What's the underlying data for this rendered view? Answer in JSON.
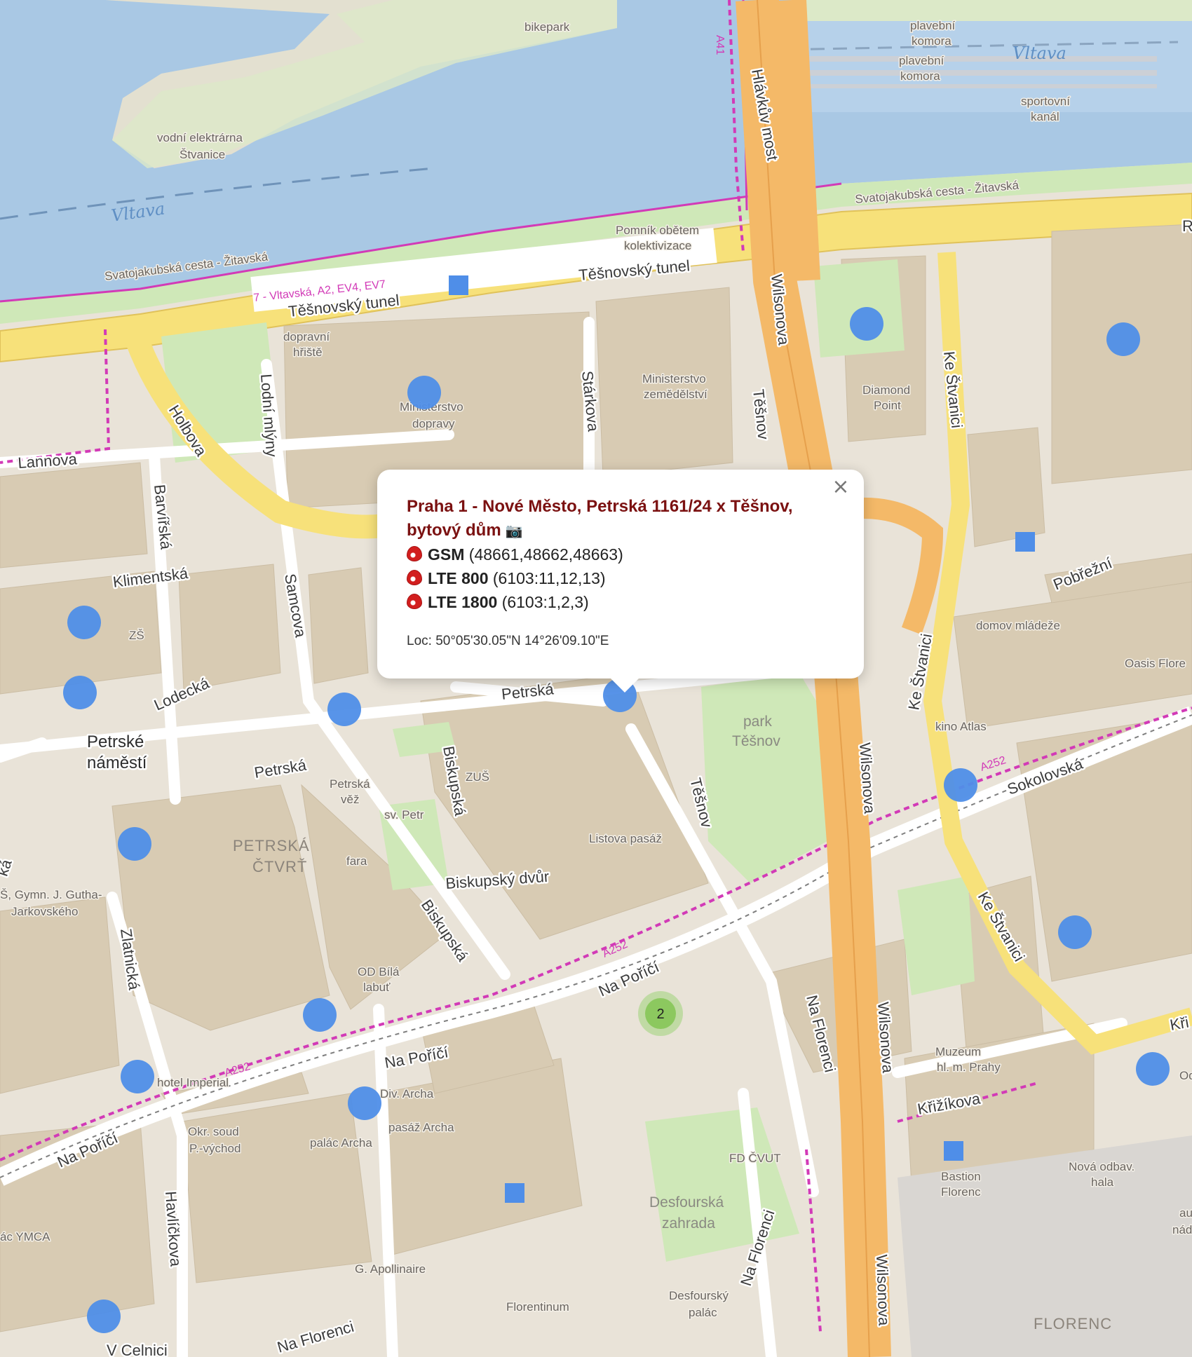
{
  "popup": {
    "title": "Praha 1 - Nové Město, Petrská 1161/24 x Těšnov, bytový dům",
    "camera_icon": "camera-icon",
    "close_glyph": "×",
    "technologies": [
      {
        "name": "GSM",
        "ids": "(48661,48662,48663)"
      },
      {
        "name": "LTE 800",
        "ids": "(6103:11,12,13)"
      },
      {
        "name": "LTE 1800",
        "ids": "(6103:1,2,3)"
      }
    ],
    "location": "Loc: 50°05'30.05\"N 14°26'09.10\"E"
  },
  "cluster": {
    "count": "2"
  },
  "labels": {
    "bikepark": "bikepark",
    "plavebni_komora_1a": "plavební",
    "plavebni_komora_1b": "komora",
    "plavebni_komora_2a": "plavební",
    "plavebni_komora_2b": "komora",
    "vltava_top": "Vltava",
    "vltava_left": "Vltava",
    "sportovni_kanal_a": "sportovní",
    "sportovni_kanal_b": "kanál",
    "vodni_elektrarna_a": "vodní elektrárna",
    "vodni_elektrarna_b": "Štvanice",
    "a41": "A41",
    "havlickuv_most": "Hlávkův most",
    "svatojakubska_right": "Svatojakubská cesta - Žitavská",
    "svatojakubska_left": "Svatojakubská cesta - Žitavská",
    "pomnik_a": "Pomník obětem",
    "pomnik_b": "kolektivizace",
    "route_7": "7 - Vltavská, A2, EV4, EV7",
    "tesnovsky_tunel_1": "Těšnovský tunel",
    "tesnovsky_tunel_2": "Těšnovský tunel",
    "dopravni_hriste_a": "dopravní",
    "dopravni_hriste_b": "hřiště",
    "lodni_mlyny": "Lodní mlýny",
    "ministerstvo_dopravy_a": "Ministerstvo",
    "ministerstvo_dopravy_b": "dopravy",
    "starkova": "Stárkova",
    "ministerstvo_zemedelstvi_a": "Ministerstvo",
    "ministerstvo_zemedelstvi_b": "zemědělství",
    "wilsonova_1": "Wilsonova",
    "tesnov_1": "Těšnov",
    "diamond_point_a": "Diamond",
    "diamond_point_b": "Point",
    "ke_stvanici_1": "Ke Štvanici",
    "holbova": "Holbova",
    "lannova": "Lannova",
    "barvirska": "Barvířská",
    "klimentska": "Klimentská",
    "samcova": "Samcova",
    "zs": "ZŠ",
    "lodecka": "Lodecká",
    "petrske_namesti_a": "Petrské",
    "petrske_namesti_b": "náměstí",
    "petrska_1": "Petrská",
    "petrska_2": "Petrská",
    "petrska_vez_a": "Petrská",
    "petrska_vez_b": "věž",
    "sv_petr": "sv. Petr",
    "biskupska_1": "Biskupská",
    "zus": "ZUŠ",
    "pobrezni": "Pobřežní",
    "domov_mladeze": "domov mládeže",
    "oasis": "Oasis Flore",
    "ke_stvanici_2": "Ke Štvanici",
    "kino_atlas": "kino Atlas",
    "park_tesnov_a": "park",
    "park_tesnov_b": "Těšnov",
    "wilsonova_2": "Wilsonova",
    "a252_1": "A252",
    "sokolovska": "Sokolovská",
    "tesnov_2": "Těšnov",
    "listova_pasaz": "Listova pasáž",
    "petrska_ctvrt_a": "PETRSKÁ",
    "petrska_ctvrt_b": "ČTVRŤ",
    "fara": "fara",
    "biskupsky_dvur": "Biskupský dvůr",
    "gymn_a": "Š, Gymn. J. Gutha-",
    "gymn_b": "Jarkovského",
    "ka": "ká",
    "zlatnicka": "Zlatnická",
    "biskupska_2": "Biskupská",
    "a252_2": "A252",
    "na_porici_1": "Na Poříčí",
    "ke_stvanici_3": "Ke Štvanici",
    "od_bila_a": "OD Bílá",
    "od_bila_b": "labuť",
    "na_florenci_1": "Na Florenci",
    "wilsonova_3": "Wilsonova",
    "kri": "Kři",
    "hotel_imperial": "hotel Imperial",
    "a252_3": "A252",
    "na_porici_2": "Na Poříčí",
    "div_archa": "Div. Archa",
    "muzeum_a": "Muzeum",
    "muzeum_b": "hl. m. Prahy",
    "krizikova": "Křižíkova",
    "na_porici_3": "Na Poříčí",
    "okr_soud_a": "Okr. soud",
    "okr_soud_b": "P.-východ",
    "palac_archa": "palác Archa",
    "pasaz_archa": "pasáž Archa",
    "fd_cvut": "FD ČVUT",
    "bastion_a": "Bastion",
    "bastion_b": "Florenc",
    "nova_odbav_a": "Nová odbav.",
    "nova_odbav_b": "hala",
    "ac_ymca": "ác YMCA",
    "havlickova": "Havlíčkova",
    "desfourska_a": "Desfourská",
    "desfourska_b": "zahrada",
    "na_florenci_2": "Na Florenci",
    "g_apollinaire": "G. Apollinaire",
    "wilsonova_4": "Wilsonova",
    "florentinum": "Florentinum",
    "desfoursky_palac_a": "Desfourský",
    "desfoursky_palac_b": "palác",
    "na_florenci_3": "Na Florenci",
    "v_celnici": "V Celnici",
    "florenc": "FLORENC",
    "au": "au",
    "nad": "nád",
    "od": "Od",
    "r": "R"
  },
  "colors": {
    "water": "#a9c8e4",
    "land": "#e9e3d8",
    "building": "#d8cbb3",
    "park": "#cfe8b8",
    "motorway": "#f4b968",
    "primary_road": "#f7e17a",
    "bike_route": "#d23ab7",
    "marker": "#4f8ee8",
    "cluster": "#9fd47a",
    "popup_title": "#7b1111"
  },
  "icons": {
    "marker": "blue-circle-marker",
    "square_marker": "blue-square-marker",
    "technology": "red-drop-icon",
    "traffic_light": "traffic-light-icon",
    "bicycle": "bicycle-icon"
  }
}
